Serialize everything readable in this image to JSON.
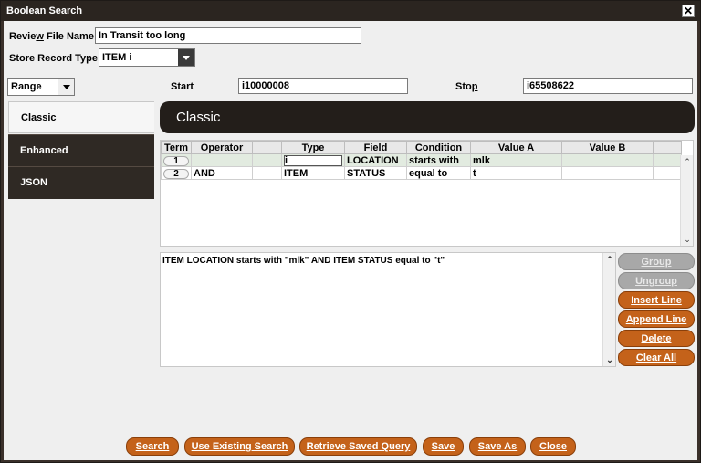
{
  "window": {
    "title": "Boolean Search"
  },
  "review": {
    "label_pre": "Revie",
    "label_u": "w",
    "label_post": " File Name:",
    "value": "In Transit too long"
  },
  "store": {
    "label": "Store Record Type:",
    "value": "ITEM  i"
  },
  "range": {
    "mode": "Range",
    "start_label": "Start",
    "start_value": "i10000008",
    "stop_label_pre": "Sto",
    "stop_label_u": "p",
    "stop_value": "i65508622"
  },
  "tabs": [
    {
      "label": "Classic"
    },
    {
      "label": "Enhanced"
    },
    {
      "label": "JSON"
    }
  ],
  "header": {
    "title": "Classic"
  },
  "grid": {
    "columns": [
      "Term",
      "Operator",
      "",
      "Type",
      "Field",
      "Condition",
      "Value A",
      "Value B",
      ""
    ],
    "rows": [
      {
        "term": "1",
        "operator": "",
        "type": "i",
        "field": "LOCATION",
        "condition": "starts with",
        "value_a": "mlk",
        "value_b": ""
      },
      {
        "term": "2",
        "operator": "AND",
        "type": "ITEM",
        "field": "STATUS",
        "condition": "equal to",
        "value_a": "t",
        "value_b": ""
      }
    ]
  },
  "expression": "ITEM  LOCATION  starts with  \"mlk\"    AND ITEM  STATUS  equal to  \"t\"",
  "side_buttons": {
    "group": "Group",
    "ungroup": "Ungroup",
    "insert_line": "Insert Line",
    "append_line": "Append Line",
    "delete": "Delete",
    "clear_all": "Clear All"
  },
  "bottom_buttons": {
    "search": "Search",
    "use_existing": "Use Existing Search",
    "retrieve": "Retrieve Saved Query",
    "save": "Save",
    "save_as": "Save As",
    "close": "Close"
  },
  "colors": {
    "accent": "#c4621a",
    "dark": "#231e1a"
  }
}
